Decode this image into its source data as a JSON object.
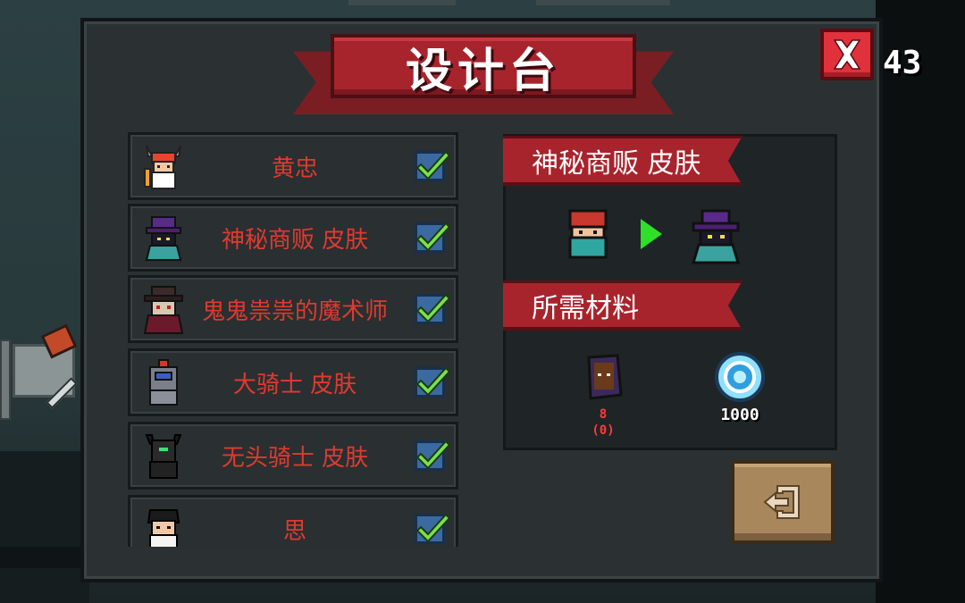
{
  "header": {
    "title": "设计台",
    "close_icon": "close-x-icon",
    "counter": "43"
  },
  "skin_list": {
    "items": [
      {
        "label": "黄忠",
        "icon": "huangzhong-avatar",
        "checked": true
      },
      {
        "label": "神秘商贩  皮肤",
        "icon": "mysterious-vendor-avatar",
        "checked": true
      },
      {
        "label": "鬼鬼祟祟的魔术师",
        "icon": "sneaky-magician-avatar",
        "checked": true
      },
      {
        "label": "大骑士  皮肤",
        "icon": "grand-knight-avatar",
        "checked": true
      },
      {
        "label": "无头骑士  皮肤",
        "icon": "headless-knight-avatar",
        "checked": true
      },
      {
        "label": "思",
        "icon": "si-avatar",
        "checked": true
      }
    ]
  },
  "detail": {
    "skin_title": "神秘商贩  皮肤",
    "preview_from_icon": "assassin-avatar",
    "arrow_icon": "play-arrow-icon",
    "preview_to_icon": "mysterious-vendor-avatar",
    "materials_title": "所需材料",
    "materials": [
      {
        "icon": "blueprint-book-icon",
        "required": "8",
        "owned": "(0)"
      },
      {
        "icon": "gem-icon",
        "required": "1000"
      }
    ],
    "exit_icon": "exit-door-icon"
  },
  "colors": {
    "accent_red": "#a8242d",
    "label_red": "#e03a2f",
    "check_green": "#7ae050",
    "gem_blue": "#3fb8f0"
  }
}
